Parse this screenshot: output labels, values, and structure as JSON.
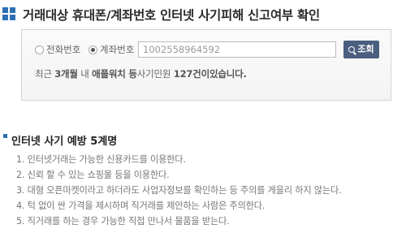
{
  "header": {
    "title": "거래대상 휴대폰/계좌번호 인터넷 사기피해 신고여부 확인"
  },
  "search": {
    "options": [
      {
        "label": "전화번호",
        "selected": false
      },
      {
        "label": "계좌번호",
        "selected": true
      }
    ],
    "input_value": "1002558964592",
    "button_label": "조회",
    "button_icon": "search-icon",
    "stat": {
      "prefix": "최근 ",
      "period": "3개월",
      "mid1": " 내 ",
      "target": "애플워치 등",
      "mid2": "사기민원 ",
      "count": "127건이있습니다."
    }
  },
  "tips": {
    "title": "인터넷 사기 예방 5계명",
    "items": [
      "1. 인터넷거래는 가능한 신용카드를 이용한다.",
      "2. 신뢰 할 수 있는 쇼핑몰 등을 이용한다.",
      "3. 대형 오픈마켓이라고 하더라도 사업자정보를 확인하는 등 주의를 게을리 하지 않는다.",
      "4. 턱 없이 싼 가격을 제시하며 직거래를 제안하는 사람은 주의한다.",
      "5. 직거래를 하는 경우 가능한 직접 만나서 물품을 받는다."
    ]
  },
  "colors": {
    "accent": "#2f6fb5",
    "button": "#4a5f80"
  }
}
